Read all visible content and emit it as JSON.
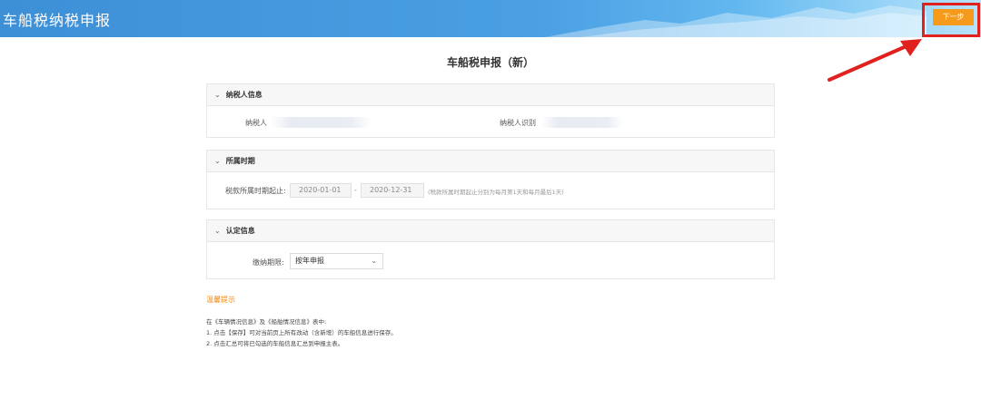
{
  "header": {
    "title": "车船税纳税申报",
    "next_button": "下一步"
  },
  "page_title": "车船税申报（新）",
  "sections": {
    "taxpayer": {
      "title": "纳税人信息",
      "name_label": "纳税人",
      "id_label": "纳税人识别"
    },
    "period": {
      "title": "所属时期",
      "range_label": "税款所属时期起止:",
      "start": "2020-01-01",
      "separator": "-",
      "end": "2020-12-31",
      "hint": "(税款所属时期起止分别为每月第1天和每月最后1天)"
    },
    "identify": {
      "title": "认定信息",
      "period_label": "缴纳期限:",
      "period_value": "按年申报"
    }
  },
  "tips": {
    "title": "温馨提示",
    "lines": [
      "在《车辆情况信息》及《船舶情况信息》表中:",
      "1. 点击【保存】可对当前页上所有改动（含新增）的车船信息进行保存。",
      "2. 点击汇总可将已勾选的车船信息汇总到申报主表。"
    ]
  },
  "colors": {
    "header_blue": "#3d8fd6",
    "next_button": "#f59a1a",
    "highlight_red": "#e0211e",
    "tips_orange": "#f08a12"
  },
  "icons": {
    "section_toggle": "chevron-down-icon",
    "select_caret": "chevron-down-icon",
    "annotation": "arrow-icon"
  }
}
